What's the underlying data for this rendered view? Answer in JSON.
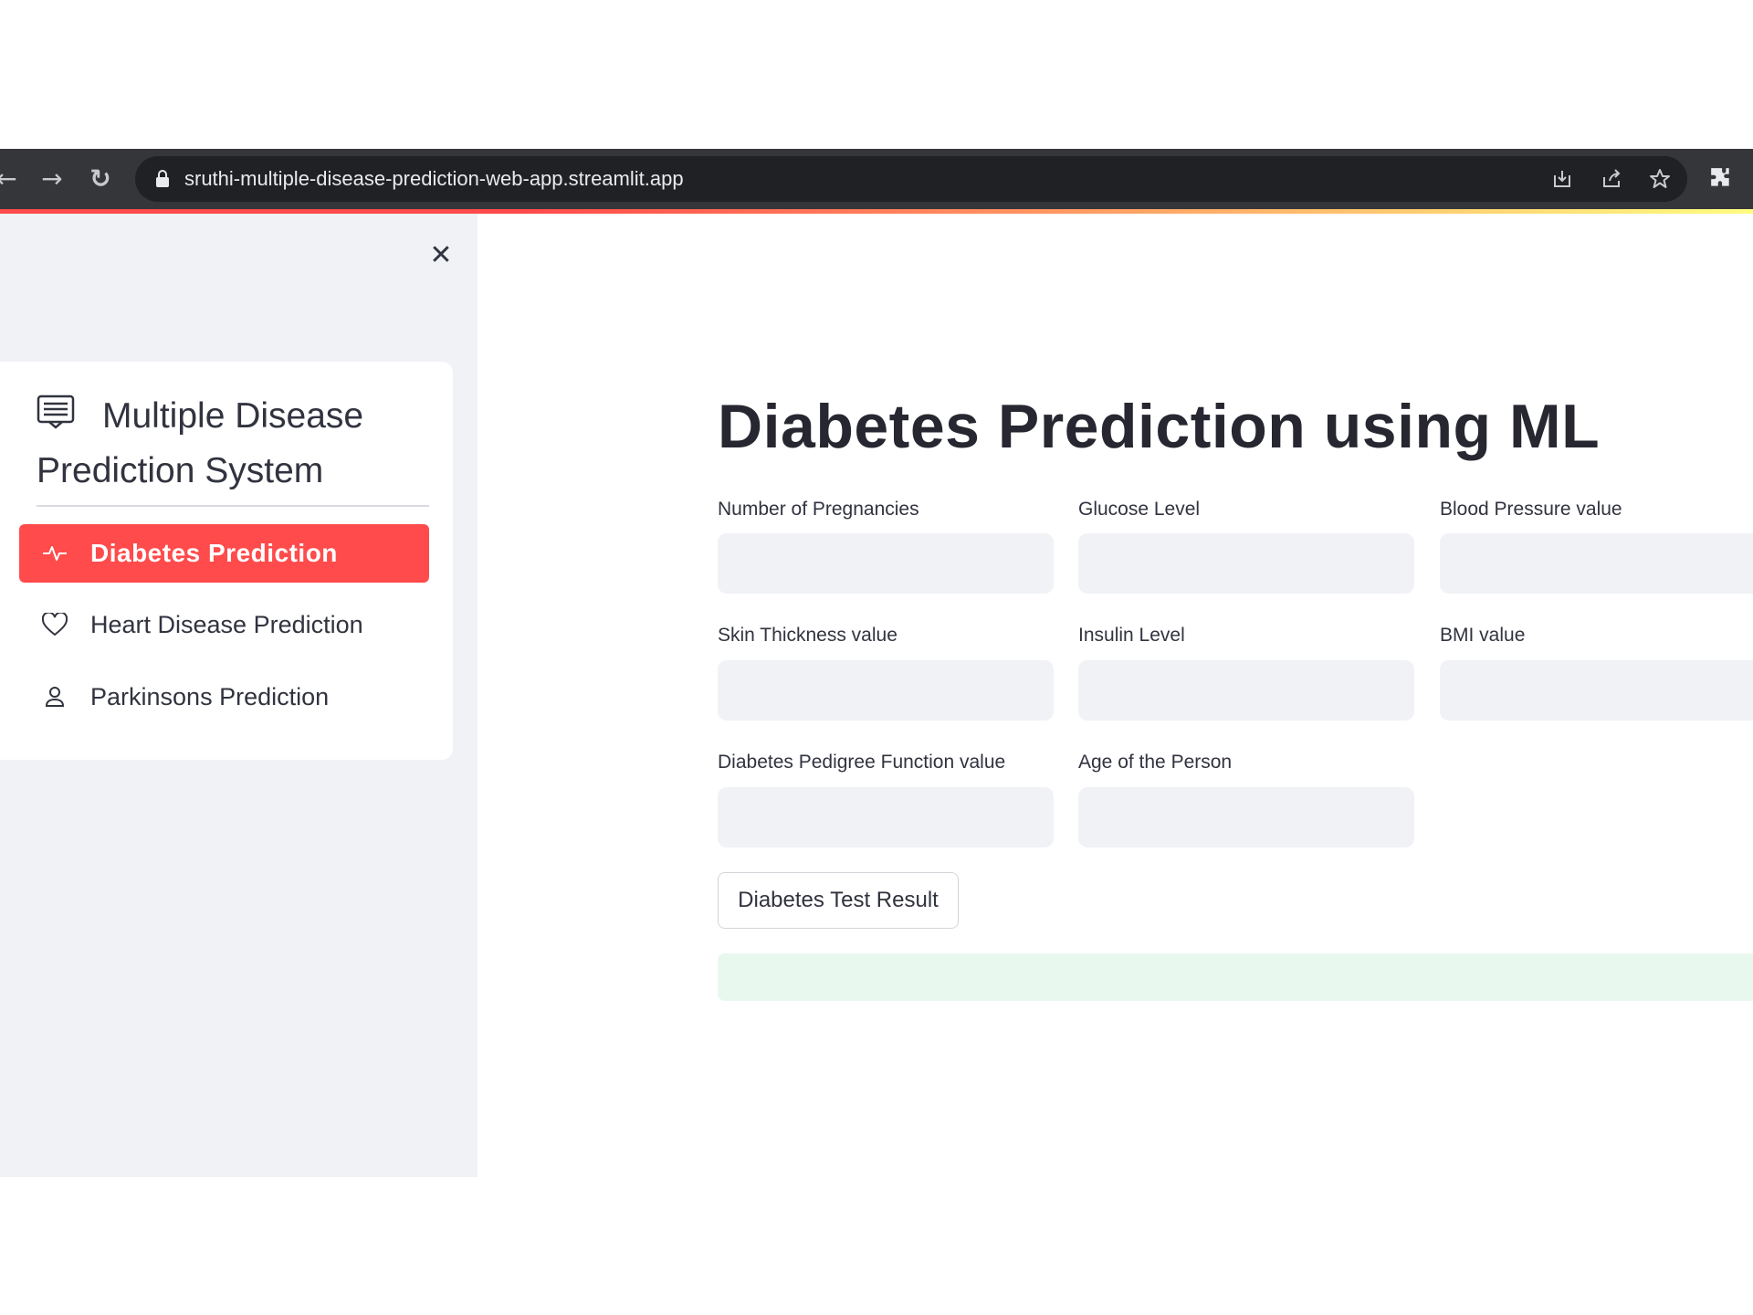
{
  "browser": {
    "url": "sruthi-multiple-disease-prediction-web-app.streamlit.app",
    "back_glyph": "←",
    "forward_glyph": "→",
    "reload_glyph": "↻"
  },
  "sidebar": {
    "close_glyph": "✕",
    "menu_title": "Multiple Disease Prediction System",
    "items": [
      {
        "label": "Diabetes Prediction",
        "icon": "activity-icon",
        "active": true
      },
      {
        "label": "Heart Disease Prediction",
        "icon": "heart-icon",
        "active": false
      },
      {
        "label": "Parkinsons Prediction",
        "icon": "person-icon",
        "active": false
      }
    ]
  },
  "main": {
    "title": "Diabetes Prediction using ML",
    "fields": [
      {
        "label": "Number of Pregnancies",
        "value": ""
      },
      {
        "label": "Glucose Level",
        "value": ""
      },
      {
        "label": "Blood Pressure value",
        "value": ""
      },
      {
        "label": "Skin Thickness value",
        "value": ""
      },
      {
        "label": "Insulin Level",
        "value": ""
      },
      {
        "label": "BMI value",
        "value": ""
      },
      {
        "label": "Diabetes Pedigree Function value",
        "value": ""
      },
      {
        "label": "Age of the Person",
        "value": ""
      }
    ],
    "submit_label": "Diabetes Test Result",
    "result_text": ""
  },
  "colors": {
    "accent": "#ff4b4b",
    "sidebar_bg": "#f0f2f6",
    "input_bg": "#f0f2f6",
    "success_bg": "#e9f8ee",
    "browser_bar": "#35363a"
  }
}
